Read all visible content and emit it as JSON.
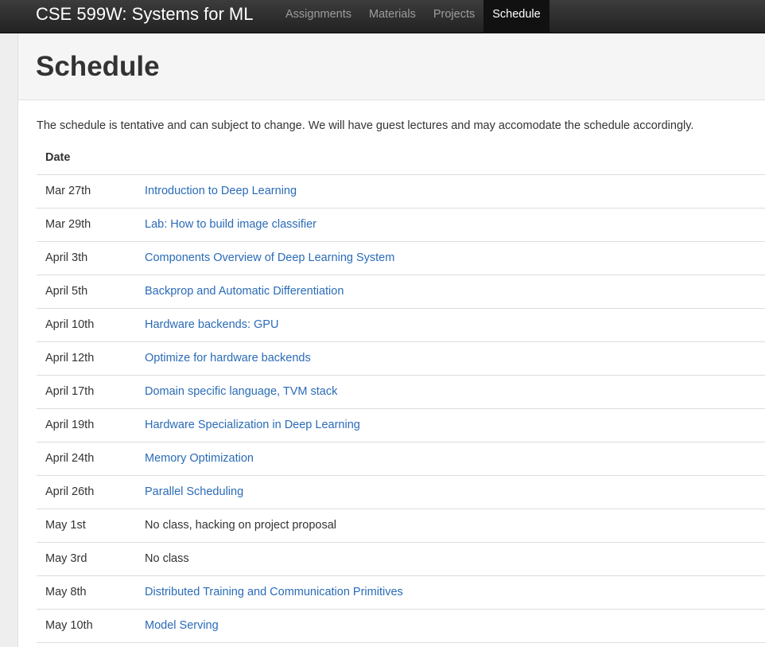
{
  "navbar": {
    "brand": "CSE 599W: Systems for ML",
    "items": [
      {
        "label": "Assignments",
        "active": false
      },
      {
        "label": "Materials",
        "active": false
      },
      {
        "label": "Projects",
        "active": false
      },
      {
        "label": "Schedule",
        "active": true
      }
    ]
  },
  "header": {
    "title": "Schedule"
  },
  "intro": "The schedule is tentative and can subject to change. We will have guest lectures and may accomodate the schedule accordingly.",
  "table": {
    "columns": [
      "Date",
      ""
    ],
    "rows": [
      {
        "date": "Mar 27th",
        "topic": "Introduction to Deep Learning",
        "link": true
      },
      {
        "date": "Mar 29th",
        "topic": "Lab: How to build image classifier",
        "link": true
      },
      {
        "date": "April 3th",
        "topic": "Components Overview of Deep Learning System",
        "link": true
      },
      {
        "date": "April 5th",
        "topic": "Backprop and Automatic Differentiation",
        "link": true
      },
      {
        "date": "April 10th",
        "topic": "Hardware backends: GPU",
        "link": true
      },
      {
        "date": "April 12th",
        "topic": "Optimize for hardware backends",
        "link": true
      },
      {
        "date": "April 17th",
        "topic": "Domain specific language, TVM stack",
        "link": true
      },
      {
        "date": "April 19th",
        "topic": "Hardware Specialization in Deep Learning",
        "link": true
      },
      {
        "date": "April 24th",
        "topic": "Memory Optimization",
        "link": true
      },
      {
        "date": "April 26th",
        "topic": "Parallel Scheduling",
        "link": true
      },
      {
        "date": "May 1st",
        "topic": "No class, hacking on project proposal",
        "link": false
      },
      {
        "date": "May 3rd",
        "topic": "No class",
        "link": false
      },
      {
        "date": "May 8th",
        "topic": "Distributed Training and Communication Primitives",
        "link": true
      },
      {
        "date": "May 10th",
        "topic": "Model Serving",
        "link": true
      }
    ]
  },
  "colors": {
    "navbar_bg": "#222222",
    "link": "#2a6bb7",
    "text": "#333333",
    "header_bg": "#f5f5f5"
  }
}
